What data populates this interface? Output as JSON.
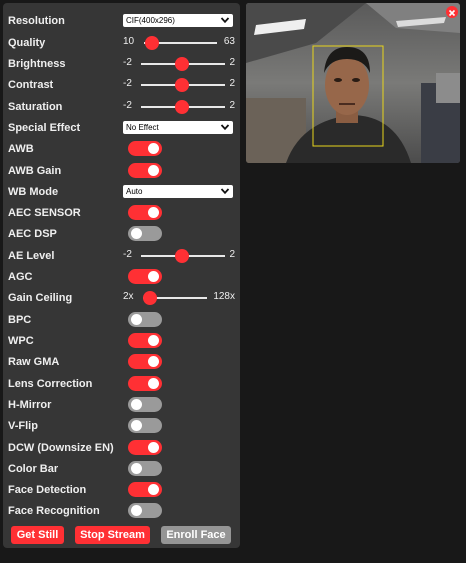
{
  "controls": {
    "resolution": {
      "label": "Resolution",
      "value": "CIF(400x296)"
    },
    "quality": {
      "label": "Quality",
      "min": "10",
      "max": "63",
      "value": 10
    },
    "brightness": {
      "label": "Brightness",
      "min": "-2",
      "max": "2",
      "value": 0
    },
    "contrast": {
      "label": "Contrast",
      "min": "-2",
      "max": "2",
      "value": 0
    },
    "saturation": {
      "label": "Saturation",
      "min": "-2",
      "max": "2",
      "value": 0
    },
    "special_effect": {
      "label": "Special Effect",
      "value": "No Effect"
    },
    "awb": {
      "label": "AWB",
      "on": true
    },
    "awb_gain": {
      "label": "AWB Gain",
      "on": true
    },
    "wb_mode": {
      "label": "WB Mode",
      "value": "Auto"
    },
    "aec_sensor": {
      "label": "AEC SENSOR",
      "on": true
    },
    "aec_dsp": {
      "label": "AEC DSP",
      "on": false
    },
    "ae_level": {
      "label": "AE Level",
      "min": "-2",
      "max": "2",
      "value": 0
    },
    "agc": {
      "label": "AGC",
      "on": true
    },
    "gain_ceiling": {
      "label": "Gain Ceiling",
      "min": "2x",
      "max": "128x",
      "value": 0
    },
    "bpc": {
      "label": "BPC",
      "on": false
    },
    "wpc": {
      "label": "WPC",
      "on": true
    },
    "raw_gma": {
      "label": "Raw GMA",
      "on": true
    },
    "lens_correction": {
      "label": "Lens Correction",
      "on": true
    },
    "h_mirror": {
      "label": "H-Mirror",
      "on": false
    },
    "v_flip": {
      "label": "V-Flip",
      "on": false
    },
    "dcw": {
      "label": "DCW (Downsize EN)",
      "on": true
    },
    "color_bar": {
      "label": "Color Bar",
      "on": false
    },
    "face_detection": {
      "label": "Face Detection",
      "on": true
    },
    "face_recognition": {
      "label": "Face Recognition",
      "on": false
    }
  },
  "buttons": {
    "get_still": "Get Still",
    "stop_stream": "Stop Stream",
    "enroll_face": "Enroll Face"
  },
  "colors": {
    "accent": "#ff3034",
    "panel": "#363636",
    "background": "#181818",
    "toggle_off": "#9a9a9a",
    "button_disabled": "#959595",
    "face_box": "#e8d51c"
  },
  "stream": {
    "icon": "close-icon"
  }
}
